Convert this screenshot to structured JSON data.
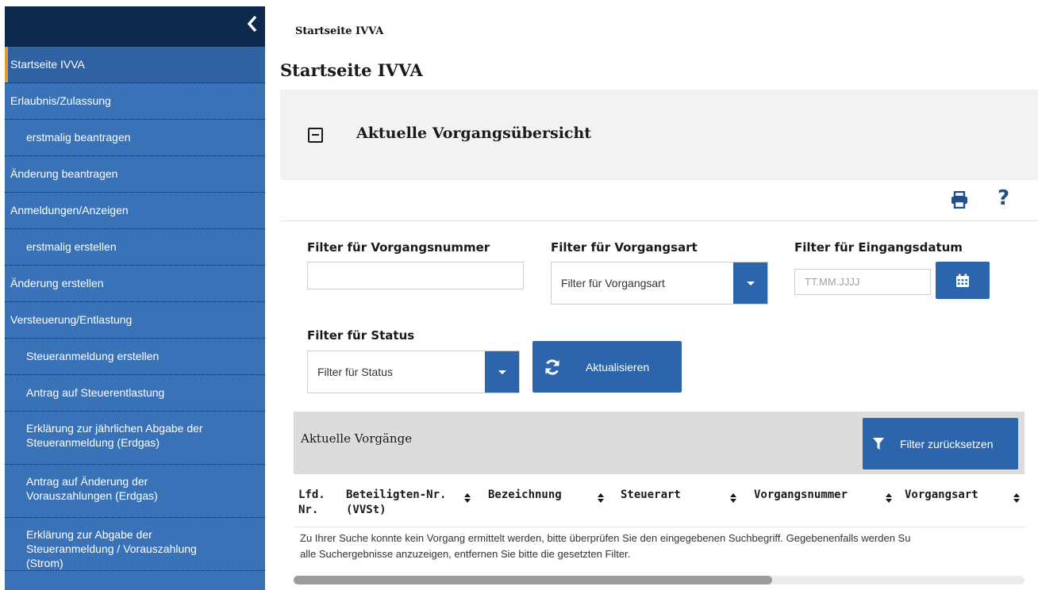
{
  "breadcrumb": "Startseite IVVA",
  "page_title": "Startseite IVVA",
  "sidebar": {
    "items": [
      {
        "label": "Startseite IVVA"
      },
      {
        "label": "Erlaubnis/Zulassung"
      },
      {
        "label": "erstmalig beantragen"
      },
      {
        "label": "Änderung beantragen"
      },
      {
        "label": "Anmeldungen/Anzeigen"
      },
      {
        "label": "erstmalig erstellen"
      },
      {
        "label": "Änderung erstellen"
      },
      {
        "label": "Versteuerung/Entlastung"
      },
      {
        "label": "Steueranmeldung erstellen"
      },
      {
        "label": "Antrag auf Steuerentlastung"
      },
      {
        "label_line1": "Erklärung zur jährlichen Abgabe der",
        "label_line2": "Steueranmeldung (Erdgas)"
      },
      {
        "label_line1": "Antrag auf Änderung der",
        "label_line2": "Vorauszahlungen (Erdgas)"
      },
      {
        "label_line1": "Erklärung zur Abgabe der",
        "label_line2": "Steueranmeldung / Vorauszahlung",
        "label_line3": "(Strom)"
      }
    ]
  },
  "panel": {
    "title": "Aktuelle Vorgangsübersicht"
  },
  "filters": {
    "vorgangsnummer": {
      "label": "Filter für Vorgangsnummer",
      "value": ""
    },
    "vorgangsart": {
      "label": "Filter für Vorgangsart",
      "selected": "Filter für Vorgangsart"
    },
    "eingangsdatum": {
      "label": "Filter für Eingangsdatum",
      "placeholder": "TT.MM.JJJJ"
    },
    "status": {
      "label": "Filter für Status",
      "selected": "Filter für Status"
    },
    "refresh_label": "Aktualisieren"
  },
  "results": {
    "title": "Aktuelle Vorgänge",
    "reset_label": "Filter zurücksetzen",
    "columns": [
      {
        "line1": "Lfd.",
        "line2": "Nr."
      },
      {
        "line1": "Beteiligten-Nr.",
        "line2": "(VVSt)"
      },
      {
        "line1": "Bezeichnung"
      },
      {
        "line1": "Steuerart"
      },
      {
        "line1": "Vorgangsnummer"
      },
      {
        "line1": "Vorgangsart"
      }
    ],
    "empty_line1": "Zu Ihrer Suche konnte kein Vorgang ermittelt werden, bitte überprüfen Sie den eingegebenen Suchbegriff. Gegebenenfalls werden Su",
    "empty_line2": "alle Suchergebnisse anzuzeigen, entfernen Sie bitte die gesetzten Filter."
  },
  "colors": {
    "sidebar_bg": "#3a72b8",
    "sidebar_top": "#0d2a4e",
    "accent": "#2d65ac",
    "active_marker": "#e59a2e"
  },
  "icons": [
    "chevron-left-icon",
    "collapse-icon",
    "print-icon",
    "help-icon",
    "calendar-icon",
    "refresh-icon",
    "filter-icon",
    "sort-icon"
  ]
}
